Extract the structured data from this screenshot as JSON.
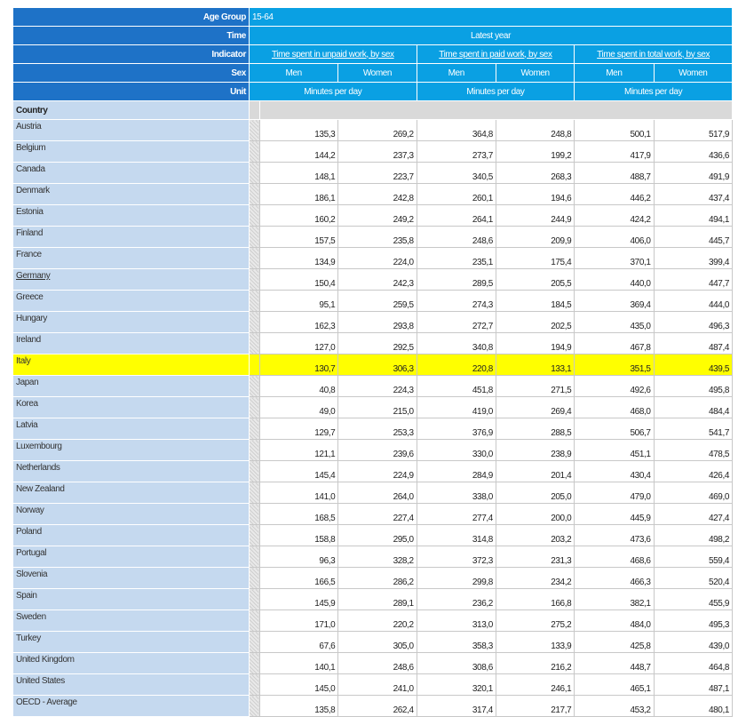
{
  "header": {
    "age_group_label": "Age Group",
    "age_group_value": "15-64",
    "time_label": "Time",
    "time_value": "Latest year",
    "indicator_label": "Indicator",
    "indicators": [
      "Time spent in unpaid work, by sex",
      "Time spent in paid work, by sex",
      "Time spent in total work, by sex"
    ],
    "sex_label": "Sex",
    "sex_values": [
      "Men",
      "Women",
      "Men",
      "Women",
      "Men",
      "Women"
    ],
    "unit_label": "Unit",
    "unit_value": "Minutes per day",
    "country_label": "Country"
  },
  "highlight_color": "#ffff00",
  "rows": [
    {
      "country": "Austria",
      "values": [
        "135,3",
        "269,2",
        "364,8",
        "248,8",
        "500,1",
        "517,9"
      ]
    },
    {
      "country": "Belgium",
      "values": [
        "144,2",
        "237,3",
        "273,7",
        "199,2",
        "417,9",
        "436,6"
      ]
    },
    {
      "country": "Canada",
      "values": [
        "148,1",
        "223,7",
        "340,5",
        "268,3",
        "488,7",
        "491,9"
      ]
    },
    {
      "country": "Denmark",
      "values": [
        "186,1",
        "242,8",
        "260,1",
        "194,6",
        "446,2",
        "437,4"
      ]
    },
    {
      "country": "Estonia",
      "values": [
        "160,2",
        "249,2",
        "264,1",
        "244,9",
        "424,2",
        "494,1"
      ]
    },
    {
      "country": "Finland",
      "values": [
        "157,5",
        "235,8",
        "248,6",
        "209,9",
        "406,0",
        "445,7"
      ]
    },
    {
      "country": "France",
      "values": [
        "134,9",
        "224,0",
        "235,1",
        "175,4",
        "370,1",
        "399,4"
      ]
    },
    {
      "country": "Germany",
      "values": [
        "150,4",
        "242,3",
        "289,5",
        "205,5",
        "440,0",
        "447,7"
      ],
      "underline": true
    },
    {
      "country": "Greece",
      "values": [
        "95,1",
        "259,5",
        "274,3",
        "184,5",
        "369,4",
        "444,0"
      ]
    },
    {
      "country": "Hungary",
      "values": [
        "162,3",
        "293,8",
        "272,7",
        "202,5",
        "435,0",
        "496,3"
      ]
    },
    {
      "country": "Ireland",
      "values": [
        "127,0",
        "292,5",
        "340,8",
        "194,9",
        "467,8",
        "487,4"
      ]
    },
    {
      "country": "Italy",
      "values": [
        "130,7",
        "306,3",
        "220,8",
        "133,1",
        "351,5",
        "439,5"
      ],
      "highlight": true
    },
    {
      "country": "Japan",
      "values": [
        "40,8",
        "224,3",
        "451,8",
        "271,5",
        "492,6",
        "495,8"
      ]
    },
    {
      "country": "Korea",
      "values": [
        "49,0",
        "215,0",
        "419,0",
        "269,4",
        "468,0",
        "484,4"
      ]
    },
    {
      "country": "Latvia",
      "values": [
        "129,7",
        "253,3",
        "376,9",
        "288,5",
        "506,7",
        "541,7"
      ]
    },
    {
      "country": "Luxembourg",
      "values": [
        "121,1",
        "239,6",
        "330,0",
        "238,9",
        "451,1",
        "478,5"
      ]
    },
    {
      "country": "Netherlands",
      "values": [
        "145,4",
        "224,9",
        "284,9",
        "201,4",
        "430,4",
        "426,4"
      ]
    },
    {
      "country": "New Zealand",
      "values": [
        "141,0",
        "264,0",
        "338,0",
        "205,0",
        "479,0",
        "469,0"
      ]
    },
    {
      "country": "Norway",
      "values": [
        "168,5",
        "227,4",
        "277,4",
        "200,0",
        "445,9",
        "427,4"
      ]
    },
    {
      "country": "Poland",
      "values": [
        "158,8",
        "295,0",
        "314,8",
        "203,2",
        "473,6",
        "498,2"
      ]
    },
    {
      "country": "Portugal",
      "values": [
        "96,3",
        "328,2",
        "372,3",
        "231,3",
        "468,6",
        "559,4"
      ]
    },
    {
      "country": "Slovenia",
      "values": [
        "166,5",
        "286,2",
        "299,8",
        "234,2",
        "466,3",
        "520,4"
      ]
    },
    {
      "country": "Spain",
      "values": [
        "145,9",
        "289,1",
        "236,2",
        "166,8",
        "382,1",
        "455,9"
      ]
    },
    {
      "country": "Sweden",
      "values": [
        "171,0",
        "220,2",
        "313,0",
        "275,2",
        "484,0",
        "495,3"
      ]
    },
    {
      "country": "Turkey",
      "values": [
        "67,6",
        "305,0",
        "358,3",
        "133,9",
        "425,8",
        "439,0"
      ]
    },
    {
      "country": "United Kingdom",
      "values": [
        "140,1",
        "248,6",
        "308,6",
        "216,2",
        "448,7",
        "464,8"
      ]
    },
    {
      "country": "United States",
      "values": [
        "145,0",
        "241,0",
        "320,1",
        "246,1",
        "465,1",
        "487,1"
      ]
    },
    {
      "country": "OECD - Average",
      "values": [
        "135,8",
        "262,4",
        "317,4",
        "217,7",
        "453,2",
        "480,1"
      ]
    }
  ]
}
